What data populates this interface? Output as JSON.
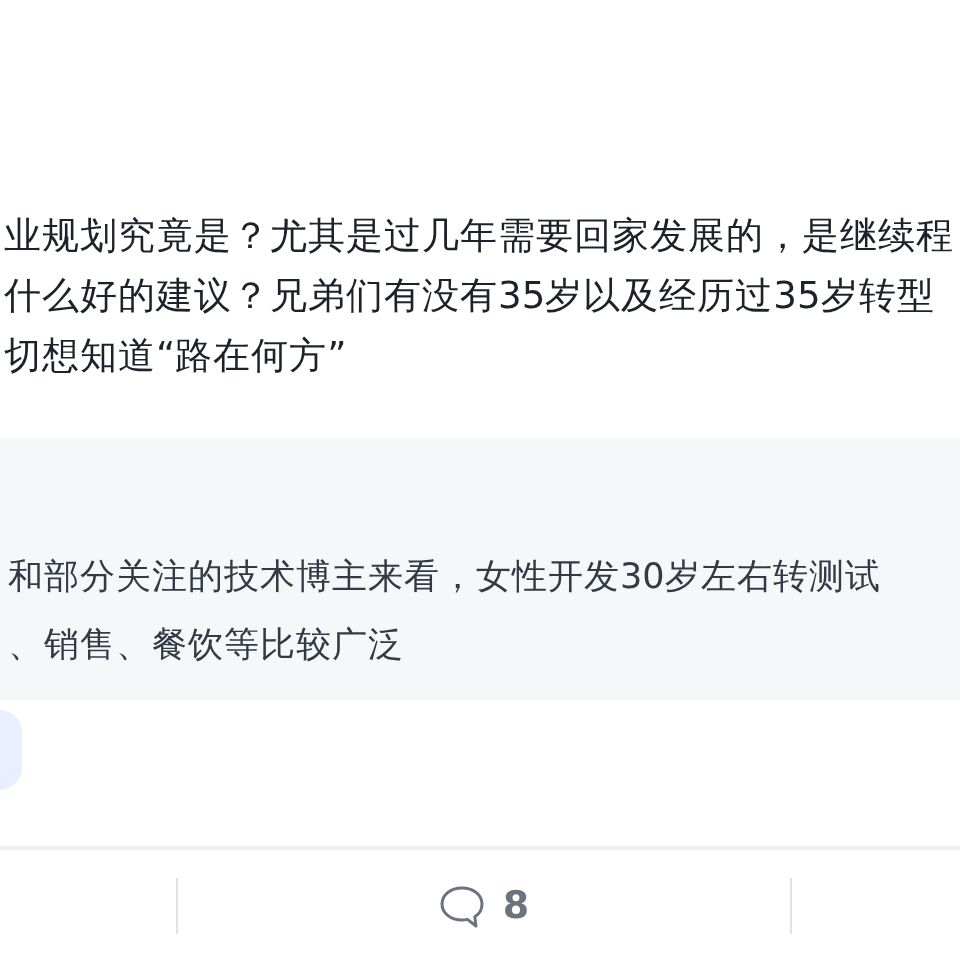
{
  "post": {
    "lines": [
      "业规划究竟是？尤其是过几年需要回家发展的，是继续程",
      "什么好的建议？兄弟们有没有35岁以及经历过35岁转型",
      "切想知道“路在何方”"
    ]
  },
  "quote": {
    "lines": [
      "和部分关注的技术博主来看，女性开发30岁左右转测试",
      "、销售、餐饮等比较广泛"
    ]
  },
  "actions": {
    "comment_count": "8"
  }
}
